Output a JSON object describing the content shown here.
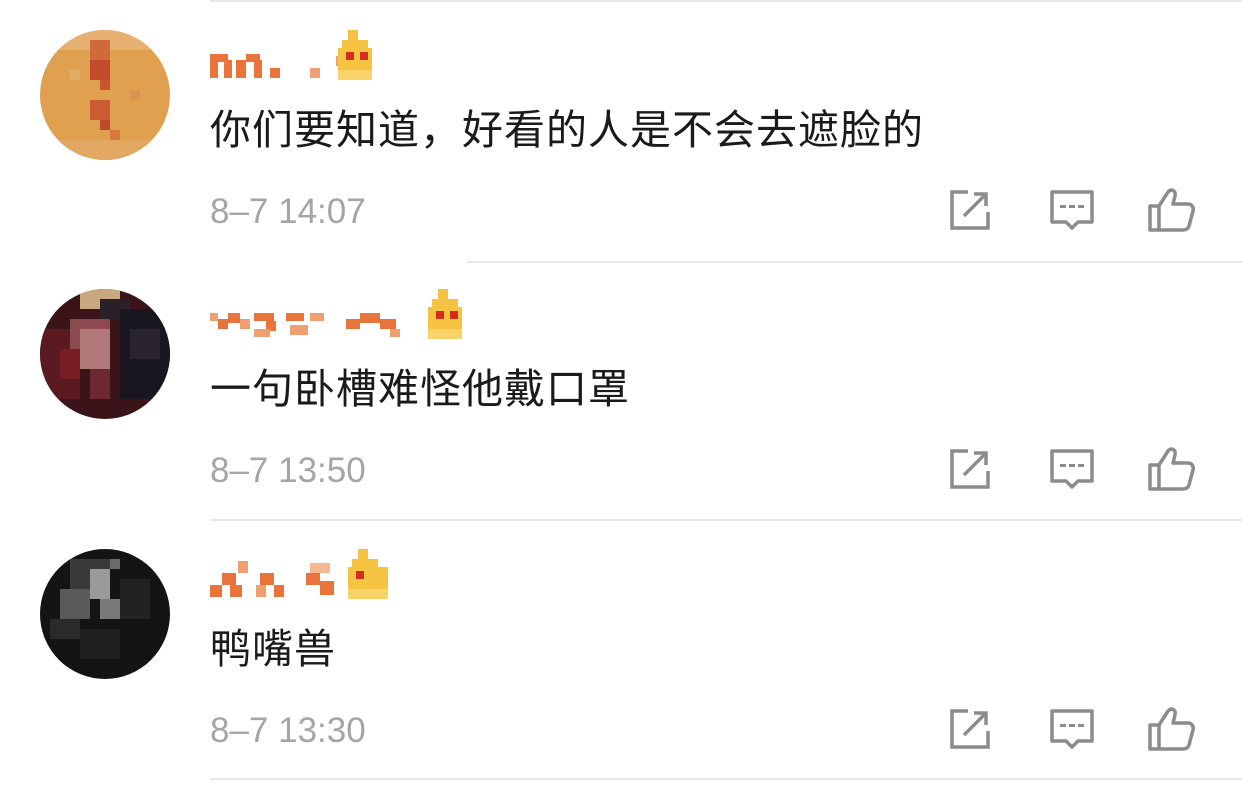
{
  "colors": {
    "username_pixels": "#e8743b",
    "badge": "#f5c242",
    "badge_accent": "#d32d20",
    "comment_text": "#1a1a1a",
    "timestamp": "#a5a5a5",
    "icon": "#8c8c8c",
    "divider": "#e8e8e8"
  },
  "icons": {
    "share": "share-icon",
    "reply": "reply-icon",
    "like": "thumbs-up-icon",
    "badge": "crown-badge-icon"
  },
  "comments": [
    {
      "text": "你们要知道，好看的人是不会去遮脸的",
      "time": "8–7 14:07",
      "avatar_style": "orange"
    },
    {
      "text": "一句卧槽难怪他戴口罩",
      "time": "8–7 13:50",
      "avatar_style": "dark-red"
    },
    {
      "text": "鸭嘴兽",
      "time": "8–7 13:30",
      "avatar_style": "dark-gray"
    }
  ]
}
